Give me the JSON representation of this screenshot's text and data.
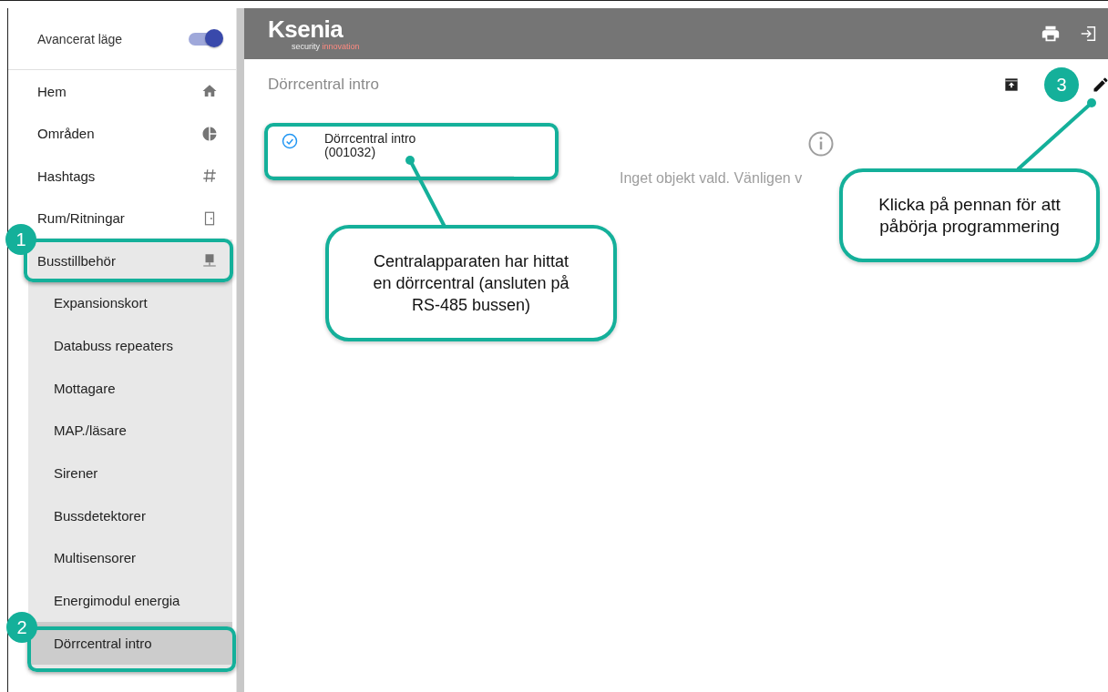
{
  "sidebar": {
    "toggle": {
      "label": "Avancerat läge",
      "on": true
    },
    "items": [
      {
        "label": "Hem",
        "kind": "home",
        "selected": false
      },
      {
        "label": "Områden",
        "kind": "pie",
        "selected": false
      },
      {
        "label": "Hashtags",
        "kind": "hash",
        "selected": false
      },
      {
        "label": "Rum/Ritningar",
        "kind": "door",
        "selected": false
      },
      {
        "label": "Busstillbehör",
        "kind": "network",
        "selected": false,
        "expanded": true,
        "children": [
          {
            "label": "Expansionskort",
            "selected": false
          },
          {
            "label": "Databuss repeaters",
            "selected": false
          },
          {
            "label": "Mottagare",
            "selected": false
          },
          {
            "label": "MAP./läsare",
            "selected": false
          },
          {
            "label": "Sirener",
            "selected": false
          },
          {
            "label": "Bussdetektorer",
            "selected": false
          },
          {
            "label": "Multisensorer",
            "selected": false
          },
          {
            "label": "Energimodul energia",
            "selected": false
          },
          {
            "label": "Dörrcentral intro",
            "selected": true
          }
        ]
      }
    ]
  },
  "header": {
    "logo": "Ksenia",
    "tagline": [
      "security",
      "innovation"
    ]
  },
  "content": {
    "title": "Dörrcentral intro",
    "devices": [
      {
        "name": "Dörrcentral intro",
        "code": "(001032)",
        "checked": true
      }
    ],
    "empty_message": "Inget objekt vald. Vänligen v"
  },
  "annotations": {
    "badges": [
      "1",
      "2",
      "3"
    ],
    "callouts": [
      "Centralapparaten har hittat en dörrcentral (ansluten på RS-485 bussen)",
      "Klicka på pennan för att påbörja programmering"
    ]
  }
}
